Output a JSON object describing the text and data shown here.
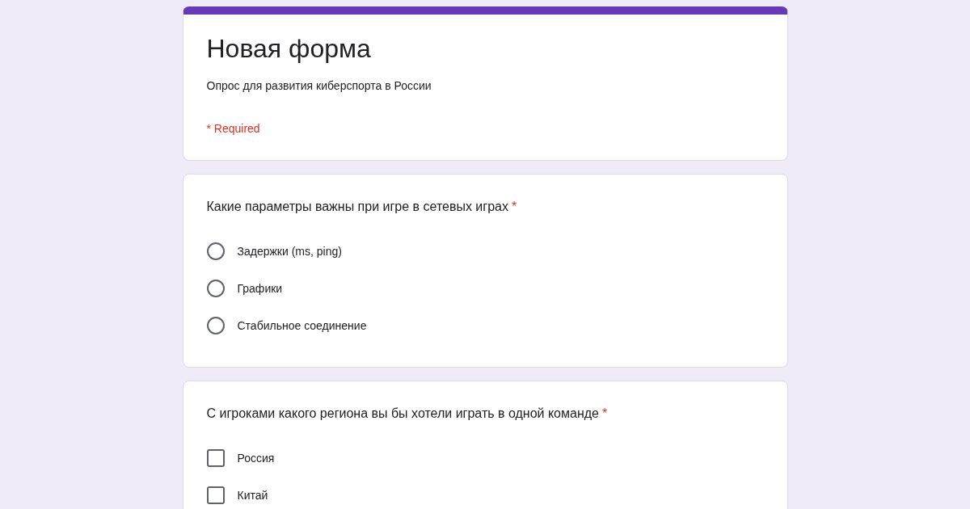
{
  "header": {
    "title": "Новая форма",
    "description": "Опрос для развития киберспорта в России",
    "required_note": "* Required"
  },
  "questions": [
    {
      "kind": "radio",
      "title": "Какие параметры важны при игре в сетевых играх",
      "required_mark": "*",
      "options": [
        {
          "label": "Задержки (ms, ping)",
          "selected": false
        },
        {
          "label": "Графики",
          "selected": false
        },
        {
          "label": "Стабильное соединение",
          "selected": false
        }
      ]
    },
    {
      "kind": "checkbox",
      "title": "С игроками какого региона вы бы хотели играть в одной команде",
      "required_mark": "*",
      "options": [
        {
          "label": "Россия",
          "checked": false
        },
        {
          "label": "Китай",
          "checked": false
        }
      ]
    }
  ]
}
